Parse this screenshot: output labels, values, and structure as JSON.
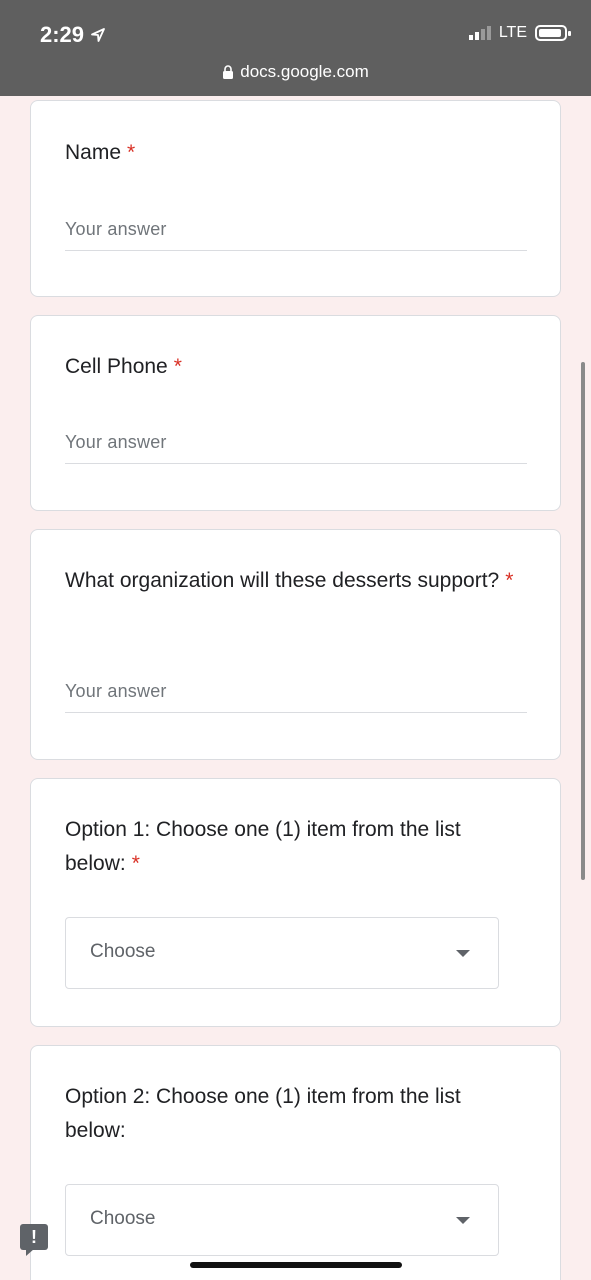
{
  "status_bar": {
    "time": "2:29",
    "network": "LTE",
    "url": "docs.google.com"
  },
  "questions": [
    {
      "title": "Name",
      "required_mark": "*",
      "placeholder": "Your answer"
    },
    {
      "title": "Cell Phone",
      "required_mark": "*",
      "placeholder": "Your answer"
    },
    {
      "title": "What organization will these desserts support?",
      "required_mark": "*",
      "placeholder": "Your answer"
    },
    {
      "title": "Option 1: Choose one (1) item from the list below:",
      "required_mark": "*",
      "dropdown_value": "Choose"
    },
    {
      "title": "Option 2: Choose one (1) item from the list below:",
      "dropdown_value": "Choose"
    }
  ],
  "feedback_button": "!",
  "colors": {
    "required": "#d93025",
    "background": "#fbeeee",
    "topbar": "#5f5f5f"
  },
  "icons": [
    "location-arrow-icon",
    "signal-icon",
    "battery-icon",
    "lock-icon",
    "dropdown-caret-icon",
    "feedback-icon"
  ]
}
